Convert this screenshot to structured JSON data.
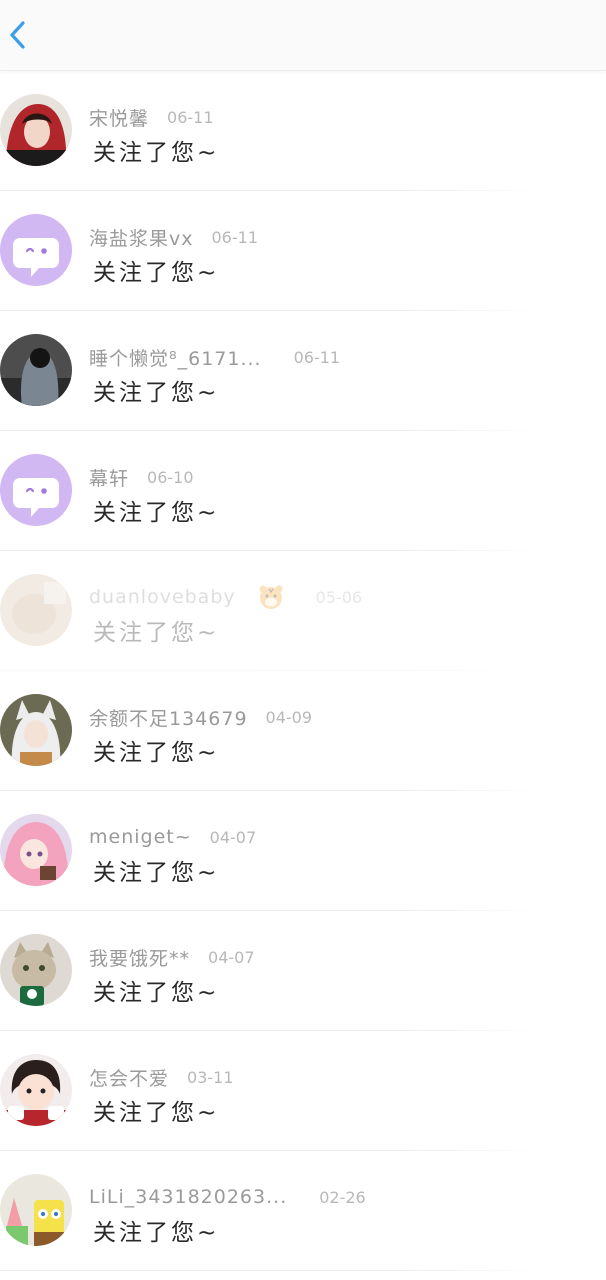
{
  "header": {
    "back_icon": "chevron-left-icon",
    "accent_color": "#3a9fe8"
  },
  "notifications": [
    {
      "name": "宋悦馨",
      "date": "06-11",
      "action": "关注了您~",
      "avatar": "red-hood-girl-photo"
    },
    {
      "name": "海盐浆果vx",
      "date": "06-11",
      "action": "关注了您~",
      "avatar": "default-purple-chat-avatar"
    },
    {
      "name": "睡个懒觉⁸_6171...",
      "date": "06-11",
      "action": "关注了您~",
      "avatar": "dark-hair-girl-photo"
    },
    {
      "name": "幕轩",
      "date": "06-10",
      "action": "关注了您~",
      "avatar": "default-purple-chat-avatar"
    },
    {
      "name": "duanlovebaby",
      "date": "05-06",
      "action": "关注了您~",
      "avatar": "beige-photo",
      "badge": "tiger-face-icon"
    },
    {
      "name": "余额不足134679",
      "date": "04-09",
      "action": "关注了您~",
      "avatar": "fox-ear-anime-girl"
    },
    {
      "name": "meniget~",
      "date": "04-07",
      "action": "关注了您~",
      "avatar": "pink-hair-anime-girl"
    },
    {
      "name": "我要饿死**",
      "date": "04-07",
      "action": "关注了您~",
      "avatar": "cat-with-cup-photo"
    },
    {
      "name": "怎会不爱",
      "date": "03-11",
      "action": "关注了您~",
      "avatar": "baby-with-mugs-photo"
    },
    {
      "name": "LiLi_3431820263...",
      "date": "02-26",
      "action": "关注了您~",
      "avatar": "patrick-spongebob-cartoon"
    }
  ]
}
